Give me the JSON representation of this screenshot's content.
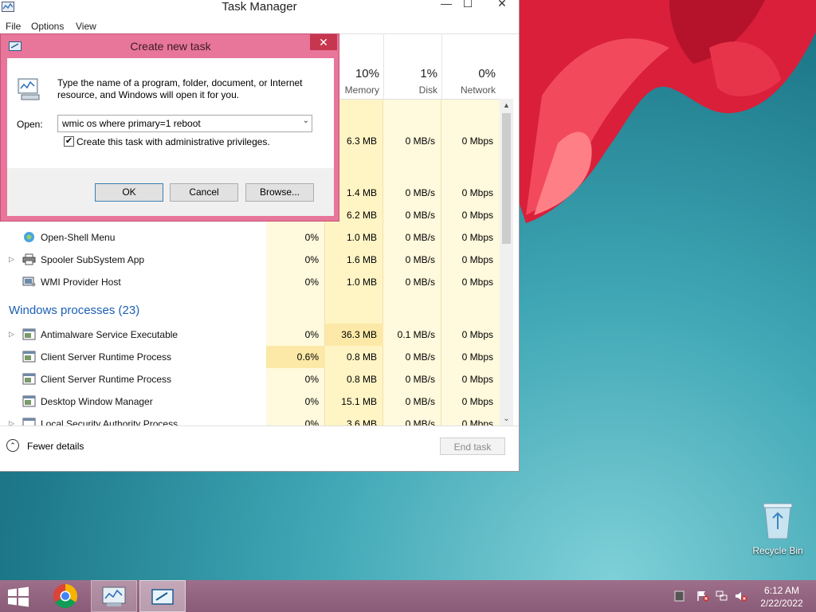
{
  "task_manager": {
    "title": "Task Manager",
    "menu": [
      "File",
      "Options",
      "View"
    ],
    "window_controls": {
      "minimize": "—",
      "maximize": "☐",
      "close": "✕"
    },
    "columns": [
      {
        "pct": "10%",
        "name": "Memory"
      },
      {
        "pct": "1%",
        "name": "Disk"
      },
      {
        "pct": "0%",
        "name": "Network"
      }
    ],
    "rows_hidden_partial": [
      {
        "mem": "6.3 MB",
        "disk": "0 MB/s",
        "net": "0 Mbps"
      },
      {
        "mem": "1.4 MB",
        "disk": "0 MB/s",
        "net": "0 Mbps"
      },
      {
        "mem": "6.2 MB",
        "disk": "0 MB/s",
        "net": "0 Mbps"
      }
    ],
    "background_rows": [
      {
        "name": "Open-Shell Menu",
        "cpu": "0%",
        "mem": "1.0 MB",
        "disk": "0 MB/s",
        "net": "0 Mbps",
        "expand": false
      },
      {
        "name": "Spooler SubSystem App",
        "cpu": "0%",
        "mem": "1.6 MB",
        "disk": "0 MB/s",
        "net": "0 Mbps",
        "expand": true
      },
      {
        "name": "WMI Provider Host",
        "cpu": "0%",
        "mem": "1.0 MB",
        "disk": "0 MB/s",
        "net": "0 Mbps",
        "expand": false
      }
    ],
    "windows_group": "Windows processes (23)",
    "windows_rows": [
      {
        "name": "Antimalware Service Executable",
        "cpu": "0%",
        "mem": "36.3 MB",
        "disk": "0.1 MB/s",
        "net": "0 Mbps",
        "expand": true
      },
      {
        "name": "Client Server Runtime Process",
        "cpu": "0.6%",
        "mem": "0.8 MB",
        "disk": "0 MB/s",
        "net": "0 Mbps",
        "expand": false
      },
      {
        "name": "Client Server Runtime Process",
        "cpu": "0%",
        "mem": "0.8 MB",
        "disk": "0 MB/s",
        "net": "0 Mbps",
        "expand": false
      },
      {
        "name": "Desktop Window Manager",
        "cpu": "0%",
        "mem": "15.1 MB",
        "disk": "0 MB/s",
        "net": "0 Mbps",
        "expand": false
      },
      {
        "name": "Local Security Authority Process",
        "cpu": "0%",
        "mem": "3.6 MB",
        "disk": "0 MB/s",
        "net": "0 Mbps",
        "expand": true
      }
    ],
    "fewer_details": "Fewer details",
    "end_task": "End task"
  },
  "run_dialog": {
    "title": "Create new task",
    "close": "✕",
    "description": "Type the name of a program, folder, document, or Internet resource, and Windows will open it for you.",
    "open_label": "Open:",
    "open_value": "wmic os where primary=1 reboot",
    "admin_checked": true,
    "admin_label": "Create this task with administrative privileges.",
    "ok": "OK",
    "cancel": "Cancel",
    "browse": "Browse..."
  },
  "desktop": {
    "recycle_bin": "Recycle Bin"
  },
  "taskbar": {
    "time": "6:12 AM",
    "date": "2/22/2022"
  }
}
